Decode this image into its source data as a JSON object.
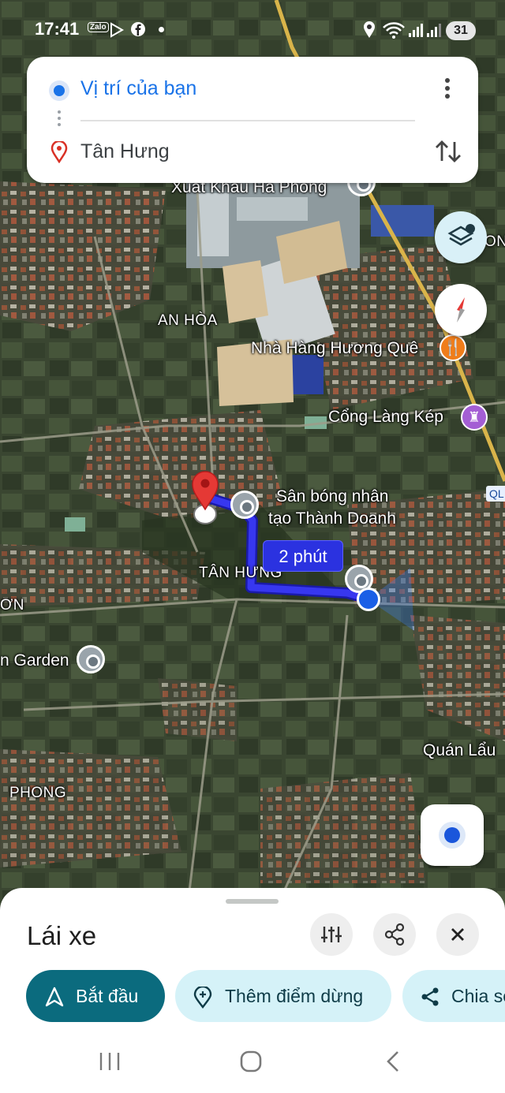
{
  "status_bar": {
    "time": "17:41",
    "apps": [
      "Zalo"
    ],
    "battery": "31",
    "icons": [
      "play-store-icon",
      "facebook-icon",
      "location-icon",
      "wifi-icon",
      "signal-icon"
    ]
  },
  "route": {
    "origin": "Vị trí của bạn",
    "destination": "Tân Hưng"
  },
  "map": {
    "labels": {
      "xuat_khau": "Xuất Khẩu Hà Phong",
      "an_hoa": "AN HÒA",
      "nha_hang": "Nhà Hàng Hương Quê",
      "cong_lang": "Cổng Làng Kép",
      "san_bong_1": "Sân bóng nhân",
      "san_bong_2": "tạo Thành Doanh",
      "tan_hung": "TÂN HƯNG",
      "garden": "n Garden",
      "quan_lau": "Quán Lẩu",
      "phong": "PHONG",
      "on_left": "ƠN",
      "on_right": "ON",
      "road_code": "QL"
    },
    "eta": "2 phút",
    "colors": {
      "route": "#2b2bdf",
      "pin": "#e53935"
    }
  },
  "sheet": {
    "mode": "Lái xe",
    "start": "Bắt đầu",
    "add_stop": "Thêm điểm dừng",
    "share": "Chia sẻ"
  }
}
